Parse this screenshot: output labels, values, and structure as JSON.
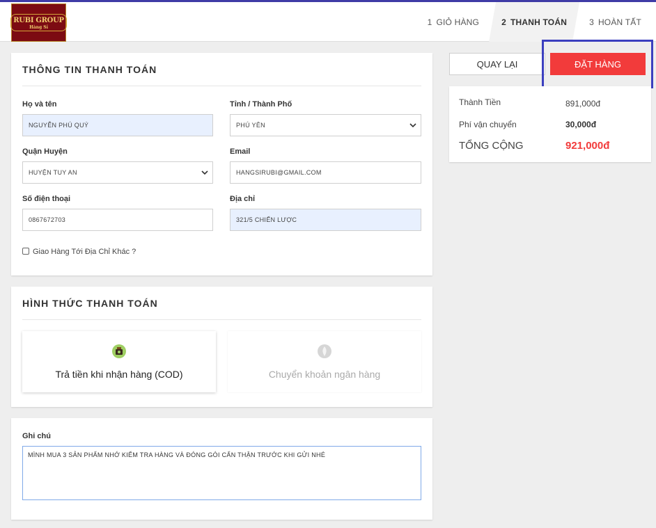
{
  "header": {
    "logo_text": "RUBI GROUP",
    "logo_sub": "Hàng Sỉ",
    "steps": [
      {
        "num": "1",
        "label": "GIỎ HÀNG"
      },
      {
        "num": "2",
        "label": "THANH TOÁN"
      },
      {
        "num": "3",
        "label": "HOÀN TẤT"
      }
    ]
  },
  "billing": {
    "title": "THÔNG TIN THANH TOÁN",
    "name_label": "Họ và tên",
    "name_value": "NGUYỄN PHÚ QUÝ",
    "province_label": "Tỉnh / Thành Phố",
    "province_value": "PHÚ YÊN",
    "district_label": "Quận Huyện",
    "district_value": "HUYỆN TUY AN",
    "email_label": "Email",
    "email_value": "HANGSIRUBI@GMAIL.COM",
    "phone_label": "Số điện thoại",
    "phone_value": "0867672703",
    "address_label": "Địa chỉ",
    "address_value": "321/5 CHIẾN LƯỢC",
    "other_address_label": "Giao Hàng Tới Địa Chỉ Khác ?"
  },
  "payment": {
    "title": "HÌNH THỨC THANH TOÁN",
    "cod_label": "Trả tiền khi nhận hàng (COD)",
    "bank_label": "Chuyển khoản ngân hàng"
  },
  "note": {
    "label": "Ghi chú",
    "value": "MÌNH MUA 3 SẢN PHẨM NHỚ KIỂM TRA HÀNG VÀ ĐÓNG GÓI CẨN THẬN TRƯỚC KHI GỬI NHÉ"
  },
  "actions": {
    "back_label": "QUAY LẠI",
    "order_label": "ĐẶT HÀNG"
  },
  "summary": {
    "subtotal_label": "Thành Tiền",
    "subtotal_value": "891,000đ",
    "shipping_label": "Phí vận chuyển",
    "shipping_value": "30,000đ",
    "total_label": "TỔNG CỘNG",
    "total_value": "921,000đ"
  },
  "colors": {
    "accent": "#f23b3b",
    "highlight": "#3b3fbf",
    "topbar": "#3f3ba6"
  }
}
